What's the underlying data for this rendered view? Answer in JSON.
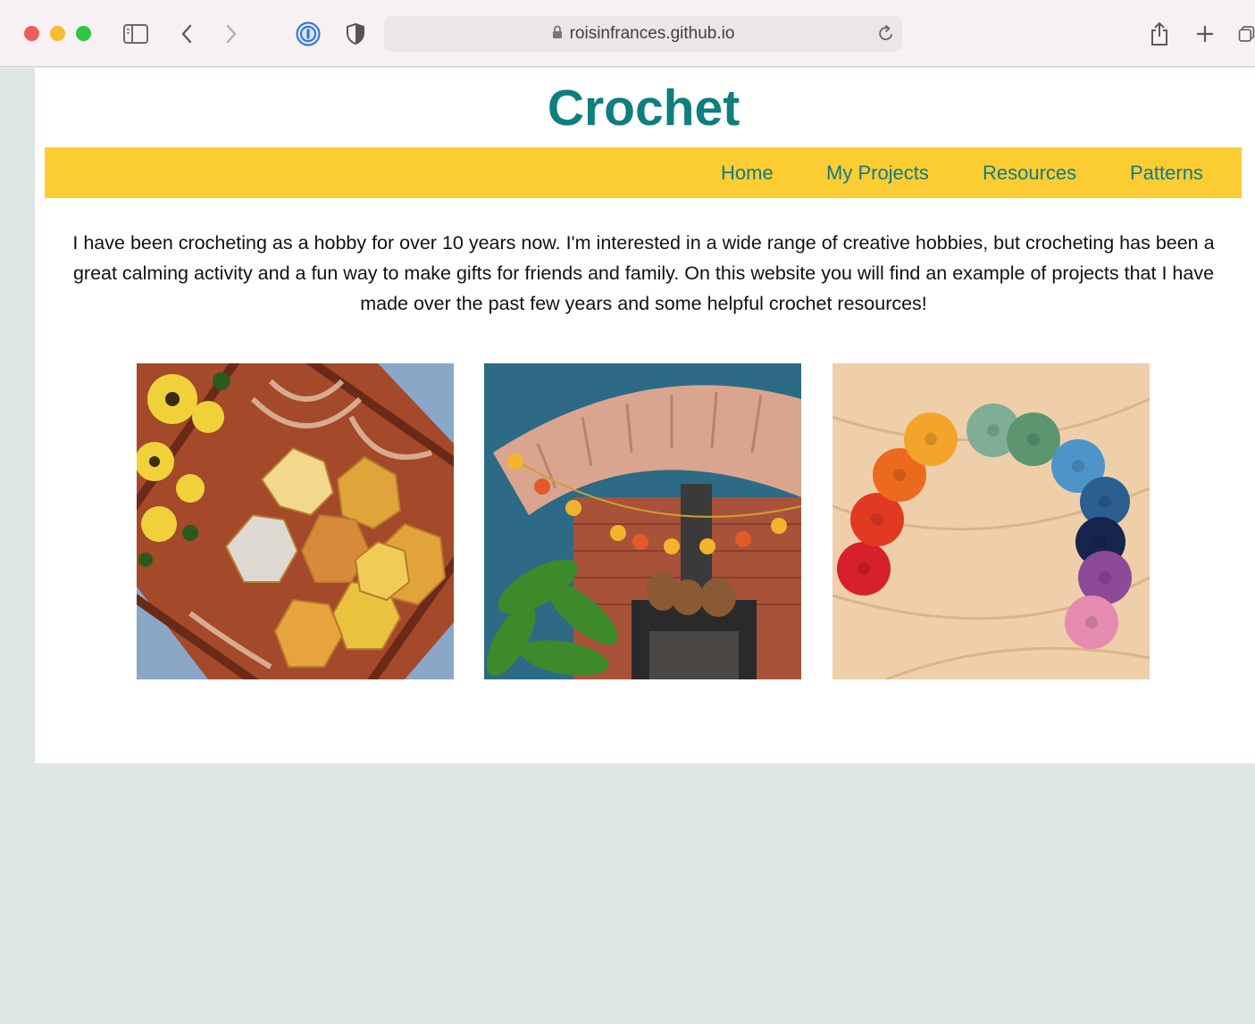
{
  "browser": {
    "url": "roisinfrances.github.io",
    "icons": [
      "sidebar-icon",
      "back-icon",
      "forward-icon",
      "password-manager-icon",
      "privacy-shield-icon",
      "lock-icon",
      "reload-icon",
      "share-icon",
      "new-tab-icon",
      "tab-overview-icon"
    ]
  },
  "site": {
    "title": "Crochet",
    "nav": [
      "Home",
      "My Projects",
      "Resources",
      "Patterns"
    ],
    "intro": "I have been crocheting as a hobby for over 10 years now. I'm interested in a wide range of creative hobbies, but crocheting has been a great calming activity and a fun way to make gifts for friends and family. On this website you will find an example of projects that I have made over the past few years and some helpful crochet resources!"
  },
  "colors": {
    "title": "#0f7e7e",
    "nav_bg": "#fccd32",
    "nav_link": "#137a84",
    "page_bg": "#dfe6e6"
  }
}
